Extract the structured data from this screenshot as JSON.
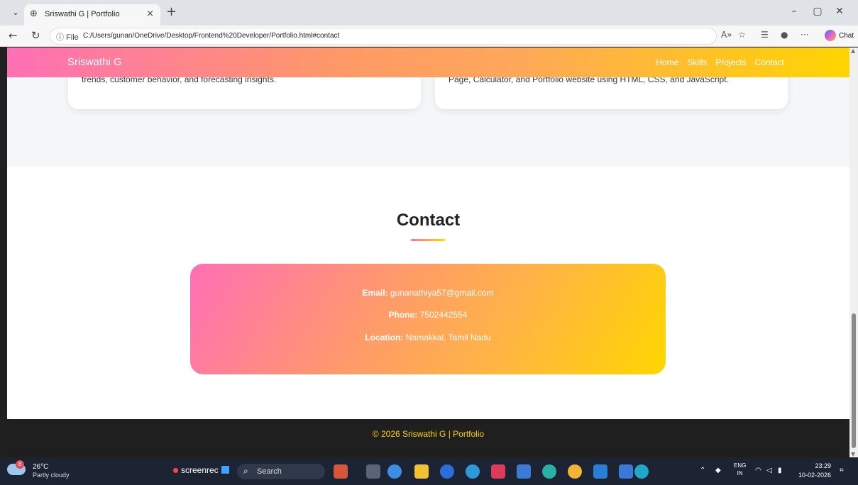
{
  "browser": {
    "tab_title": "Sriswathi G | Portfolio",
    "tab_close": "×",
    "new_tab": "+",
    "url_info": "ⓘ File",
    "url": "C:/Users/gunan/OneDrive/Desktop/Frontend%20Developer/Portfolio.html#contact",
    "chat_label": "Chat"
  },
  "navbar": {
    "brand": "Sriswathi G",
    "links": [
      "Home",
      "Skills",
      "Projects",
      "Contact"
    ]
  },
  "projects": {
    "card1_text": "trends, customer behavior, and forecasting insights.",
    "card2_text": "Page, Calculator, and Portfolio website using HTML, CSS, and JavaScript."
  },
  "contact": {
    "title": "Contact",
    "email_label": "Email:",
    "email_value": "gunanathiya57@gmail.com",
    "phone_label": "Phone:",
    "phone_value": "7502442554",
    "location_label": "Location:",
    "location_value": "Namakkal, Tamil Nadu"
  },
  "footer": {
    "text": "© 2026 Sriswathi G | Portfolio"
  },
  "taskbar": {
    "weather_badge": "8",
    "temperature": "26°C",
    "condition": "Partly cloudy",
    "screenrec": "screenrec",
    "search_placeholder": "Search",
    "lang_line1": "ENG",
    "lang_line2": "IN",
    "time": "23:29",
    "date": "10-02-2026"
  },
  "colors": {
    "gradient_pink": "#ff6fb5",
    "gradient_orange": "#ffa75a",
    "gradient_yellow": "#ffd500",
    "footer_text": "#ffd000",
    "footer_bg": "#1f1f1f"
  }
}
